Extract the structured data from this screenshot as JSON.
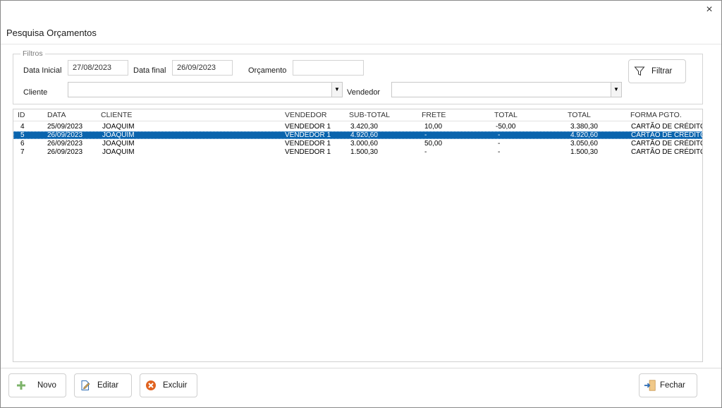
{
  "window": {
    "title": "Pesquisa Orçamentos",
    "close_glyph": "×"
  },
  "filters": {
    "legend": "Filtros",
    "data_inicial_label": "Data Inicial",
    "data_inicial_value": "27/08/2023",
    "data_final_label": "Data final",
    "data_final_value": "26/09/2023",
    "orcamento_label": "Orçamento",
    "orcamento_value": "",
    "cliente_label": "Cliente",
    "cliente_value": "",
    "vendedor_label": "Vendedor",
    "vendedor_value": "",
    "filtrar_label": "Filtrar"
  },
  "grid": {
    "columns": [
      "ID",
      "DATA",
      "CLIENTE",
      "VENDEDOR",
      "SUB-TOTAL",
      "FRETE",
      "TOTAL",
      "TOTAL",
      "FORMA PGTO."
    ],
    "rows": [
      {
        "id": "4",
        "data": "25/09/2023",
        "cliente": "JOAQUIM",
        "vendedor": "VENDEDOR 1",
        "subtotal": "3.420,30",
        "frete": "10,00",
        "desconto": "-50,00",
        "total": "3.380,30",
        "forma": "CARTÃO DE CRÉDITO",
        "selected": false
      },
      {
        "id": "5",
        "data": "26/09/2023",
        "cliente": "JOAQUIM",
        "vendedor": "VENDEDOR 1",
        "subtotal": "4.920,60",
        "frete": "-",
        "desconto": "-",
        "total": "4.920,60",
        "forma": "CARTÃO DE CRÉDITO",
        "selected": true
      },
      {
        "id": "6",
        "data": "26/09/2023",
        "cliente": "JOAQUIM",
        "vendedor": "VENDEDOR 1",
        "subtotal": "3.000,60",
        "frete": "50,00",
        "desconto": "-",
        "total": "3.050,60",
        "forma": "CARTÃO DE CRÉDITO",
        "selected": false
      },
      {
        "id": "7",
        "data": "26/09/2023",
        "cliente": "JOAQUIM",
        "vendedor": "VENDEDOR 1",
        "subtotal": "1.500,30",
        "frete": "-",
        "desconto": "-",
        "total": "1.500,30",
        "forma": "CARTÃO DE CRÉDITO",
        "selected": false
      }
    ]
  },
  "actions": {
    "novo": "Novo",
    "editar": "Editar",
    "excluir": "Excluir",
    "fechar": "Fechar"
  },
  "icons": {
    "novo": "plus-icon",
    "editar": "edit-icon",
    "excluir": "delete-icon",
    "fechar": "exit-door-icon",
    "filtrar": "filter-icon",
    "close": "close-icon"
  },
  "colors": {
    "selection": "#0a64ad",
    "plus_green": "#7cb36a",
    "delete_orange": "#e0621f",
    "edit_blue": "#2f6eb5"
  }
}
